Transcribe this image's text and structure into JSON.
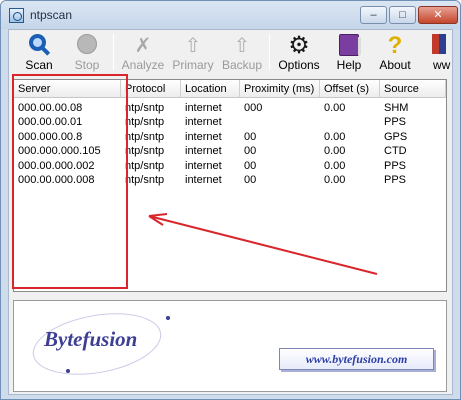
{
  "window": {
    "title": "ntpscan",
    "min_glyph": "–",
    "max_glyph": "□",
    "close_glyph": "✕"
  },
  "toolbar": {
    "buttons": [
      {
        "label": "Scan",
        "enabled": true,
        "icon": "magnifier-icon"
      },
      {
        "label": "Stop",
        "enabled": false,
        "icon": "stop-icon"
      },
      {
        "label": "Analyze",
        "enabled": false,
        "icon": "analyze-icon"
      },
      {
        "label": "Primary",
        "enabled": false,
        "icon": "primary-arrow-icon"
      },
      {
        "label": "Backup",
        "enabled": false,
        "icon": "backup-arrow-icon"
      },
      {
        "label": "Options",
        "enabled": true,
        "icon": "gear-icon"
      },
      {
        "label": "Help",
        "enabled": true,
        "icon": "help-book-icon"
      },
      {
        "label": "About",
        "enabled": true,
        "icon": "question-mark-icon"
      },
      {
        "label": "ww",
        "enabled": true,
        "icon": "www-icon"
      }
    ],
    "glyphs": {
      "analyze": "✗",
      "arrow_up": "⇧",
      "gear": "⚙",
      "about": "?"
    }
  },
  "table": {
    "columns": [
      "Server",
      "Protocol",
      "Location",
      "Proximity (ms)",
      "Offset (s)",
      "Source"
    ],
    "rows": [
      [
        "000.00.00.08",
        "ntp/sntp",
        "internet",
        "000",
        "0.00",
        "SHM"
      ],
      [
        "000.00.00.01",
        "ntp/sntp",
        "internet",
        "",
        "",
        "PPS"
      ],
      [
        "000.000.00.8",
        "ntp/sntp",
        "internet",
        "00",
        "0.00",
        "GPS"
      ],
      [
        "000.000.000.105",
        "ntp/sntp",
        "internet",
        "00",
        "0.00",
        "CTD"
      ],
      [
        "000.00.000.002",
        "ntp/sntp",
        "internet",
        "00",
        "0.00",
        "PPS"
      ],
      [
        "000.00.000.008",
        "ntp/sntp",
        "internet",
        "00",
        "0.00",
        "PPS"
      ]
    ]
  },
  "branding": {
    "logo": "Bytefusion",
    "url": "www.bytefusion.com"
  },
  "colors": {
    "highlight": "#d8262c",
    "arrow": "#d8262c",
    "logo": "#3d3f94"
  }
}
